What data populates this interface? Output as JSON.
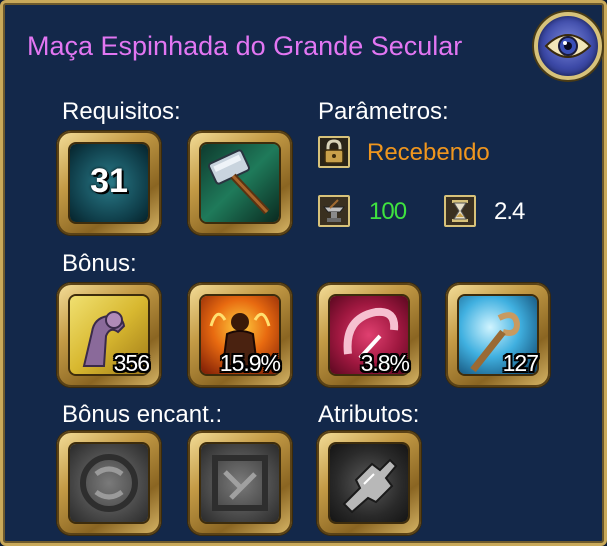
{
  "item": {
    "title": "Maça Espinhada do Grande Secular",
    "title_color": "#e276f2"
  },
  "sections": {
    "requirements": "Requisitos:",
    "parameters": "Parâmetros:",
    "bonus": "Bônus:",
    "enchant_bonus": "Bônus encant.:",
    "attributes": "Atributos:"
  },
  "requirements": {
    "level": "31",
    "weapon_icon": "mace-hammer-icon"
  },
  "parameters": {
    "binding": "Recebendo",
    "binding_color": "#f0961e",
    "binding_icon": "padlock-icon",
    "durability": "100",
    "durability_color": "#3fe23f",
    "durability_icon": "anvil-icon",
    "speed": "2.4",
    "speed_icon": "hourglass-icon"
  },
  "bonuses": [
    {
      "icon": "strength-arm-icon",
      "value": "356"
    },
    {
      "icon": "fire-warrior-icon",
      "value": "15.9%"
    },
    {
      "icon": "crit-slash-icon",
      "value": "3.8%"
    },
    {
      "icon": "staff-magic-icon",
      "value": "127"
    }
  ],
  "enchant_bonuses": [
    {
      "icon": "rune-stone-round-icon"
    },
    {
      "icon": "rune-stone-square-icon"
    }
  ],
  "attributes": [
    {
      "icon": "broken-gear-attribute-icon"
    }
  ]
}
